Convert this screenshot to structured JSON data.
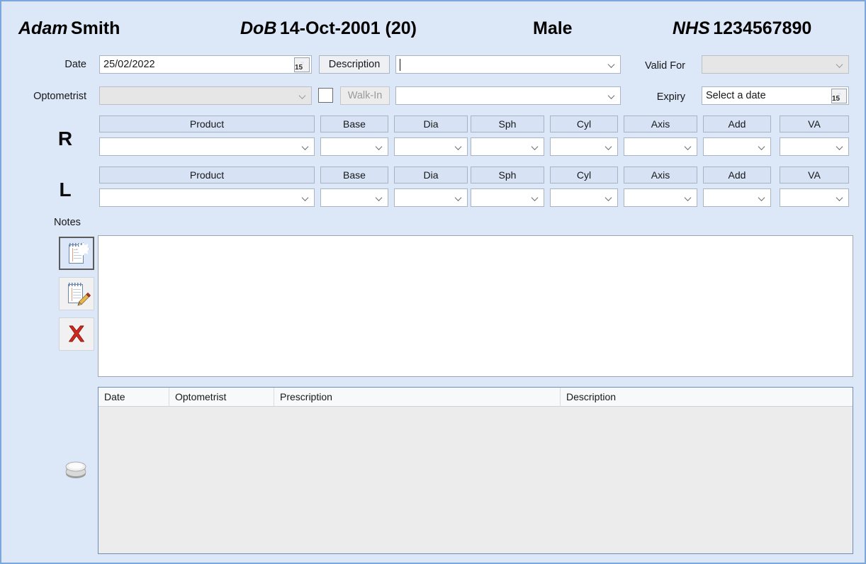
{
  "patient": {
    "name_first": "Adam",
    "name_last": "Smith",
    "dob_label": "DoB",
    "dob_value": "14-Oct-2001 (20)",
    "gender": "Male",
    "nhs_label": "NHS",
    "nhs_value": "1234567890"
  },
  "form": {
    "date_label": "Date",
    "date_value": "25/02/2022",
    "date_cal_day": "15",
    "description_button": "Description",
    "description_value": "",
    "valid_for_label": "Valid For",
    "valid_for_value": "",
    "optometrist_label": "Optometrist",
    "optometrist_value": "",
    "walkin_button": "Walk-In",
    "walkin_checked": false,
    "prescription_type_value": "",
    "expiry_label": "Expiry",
    "expiry_placeholder": "Select a date",
    "expiry_cal_day": "15"
  },
  "rx_grid": {
    "columns": [
      "Product",
      "Base",
      "Dia",
      "Sph",
      "Cyl",
      "Axis",
      "Add",
      "VA"
    ],
    "rows": [
      {
        "eye": "R",
        "values": [
          "",
          "",
          "",
          "",
          "",
          "",
          "",
          ""
        ]
      },
      {
        "eye": "L",
        "values": [
          "",
          "",
          "",
          "",
          "",
          "",
          "",
          ""
        ]
      }
    ]
  },
  "notes": {
    "label": "Notes",
    "text": "",
    "toolbar": [
      {
        "name": "new-note",
        "icon": "notepad-star-icon",
        "selected": true
      },
      {
        "name": "edit-note",
        "icon": "notepad-pencil-icon",
        "selected": false
      },
      {
        "name": "delete-note",
        "icon": "red-x-icon",
        "selected": false
      }
    ]
  },
  "history_table": {
    "columns": [
      "Date",
      "Optometrist",
      "Prescription",
      "Description"
    ],
    "rows": [],
    "side_icon": "database-icon"
  },
  "colors": {
    "page_bg": "#dce7f7",
    "page_border": "#7ba7dd",
    "header_cell_bg": "#d7e2f4",
    "table_body_bg": "#ececec",
    "accent_blue": "#3f7fcf",
    "delete_red": "#c8281e"
  }
}
